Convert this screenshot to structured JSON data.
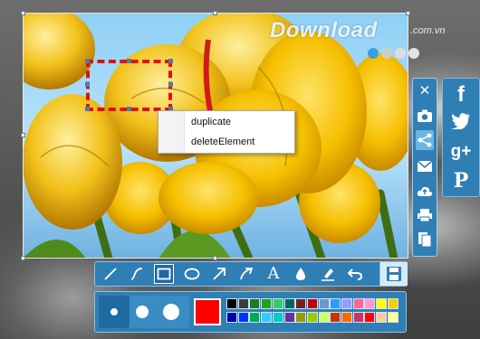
{
  "watermark": {
    "text": "Download",
    "domain": ".com.vn"
  },
  "context_menu": {
    "items": [
      "duplicate",
      "deleteElement"
    ]
  },
  "vertical_toolbar": {
    "tools": [
      "close",
      "camera",
      "share",
      "email",
      "upload",
      "print",
      "copy"
    ],
    "active": "share"
  },
  "share_panel": {
    "networks": [
      {
        "name": "facebook",
        "glyph": "f"
      },
      {
        "name": "twitter",
        "glyph": ""
      },
      {
        "name": "google-plus",
        "glyph": "g+"
      },
      {
        "name": "pinterest",
        "glyph": "P"
      }
    ]
  },
  "draw_toolbar": {
    "tools": [
      "line",
      "curve",
      "rectangle",
      "ellipse",
      "arrow",
      "curved-arrow",
      "text",
      "blur-drop",
      "marker",
      "undo",
      "save"
    ],
    "active": "rectangle",
    "text_tool_glyph": "A"
  },
  "palette": {
    "sizes": [
      "small",
      "medium",
      "large"
    ],
    "active_size": "small",
    "current_color": "#ff0000",
    "colors": [
      "#000000",
      "#3d3d3d",
      "#1f7a1f",
      "#1ea31e",
      "#33cc66",
      "#006666",
      "#7a1f1f",
      "#c00000",
      "#6699cc",
      "#3399ff",
      "#9999ff",
      "#ff6699",
      "#ff99cc",
      "#ffff00",
      "#ffcc00",
      "#0000aa",
      "#0033ff",
      "#00aa55",
      "#33ccff",
      "#00cccc",
      "#663399",
      "#999900",
      "#99cc00",
      "#ccff66",
      "#cc3300",
      "#ff6600",
      "#cc3366",
      "#ff0000",
      "#ffcc99",
      "#ffff99"
    ]
  },
  "watermark_dots": [
    "#3aa0dc",
    "#cccccc",
    "#dddddd",
    "#e4e4e4"
  ]
}
